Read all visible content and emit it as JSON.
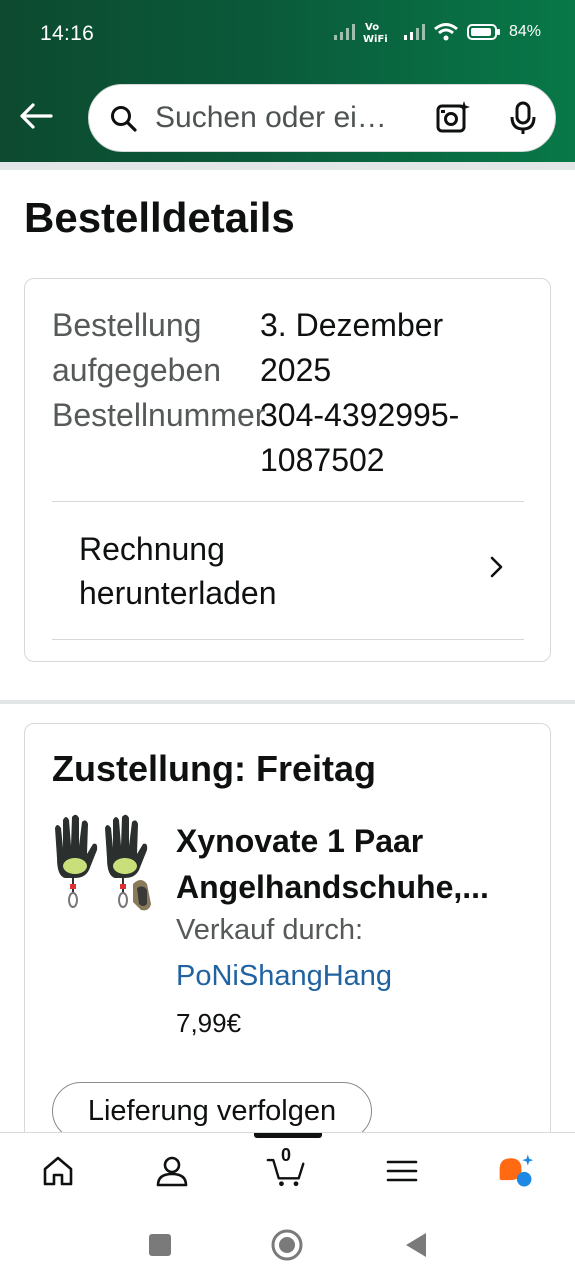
{
  "status_bar": {
    "time": "14:16",
    "battery": "84%",
    "icons": [
      "signal-icon",
      "vowifi-icon",
      "signal-icon",
      "wifi-icon",
      "battery-icon"
    ]
  },
  "search": {
    "placeholder": "Suchen oder ei…",
    "icons": [
      "back-arrow-icon",
      "search-icon",
      "camera-icon",
      "mic-icon"
    ]
  },
  "page": {
    "title": "Bestelldetails"
  },
  "order_info": {
    "placed_label_line1": "Bestellung",
    "placed_label_line2": "aufgegeben",
    "placed_value_line1": "3. Dezember",
    "placed_value_line2": "2025",
    "number_label": "Bestellnummer",
    "number_value_line1": "304-4392995-",
    "number_value_line2": "1087502",
    "invoice_line1": "Rechnung",
    "invoice_line2": "herunterladen"
  },
  "delivery": {
    "title": "Zustellung: Freitag",
    "product_title_line1": "Xynovate 1 Paar",
    "product_title_line2": "Angelhandschuhe,...",
    "sold_by_label": "Verkauf durch:",
    "seller": "PoNiShangHang",
    "price": "7,99€",
    "track_button": "Lieferung verfolgen"
  },
  "bottom_nav": {
    "items": [
      "home-icon",
      "account-icon",
      "cart-icon",
      "menu-icon",
      "rufus-icon"
    ],
    "cart_count": "0"
  },
  "colors": {
    "header_start": "#0d4a2f",
    "header_end": "#087848",
    "link": "#2162a1",
    "text": "#0f1111",
    "muted": "#565959"
  }
}
